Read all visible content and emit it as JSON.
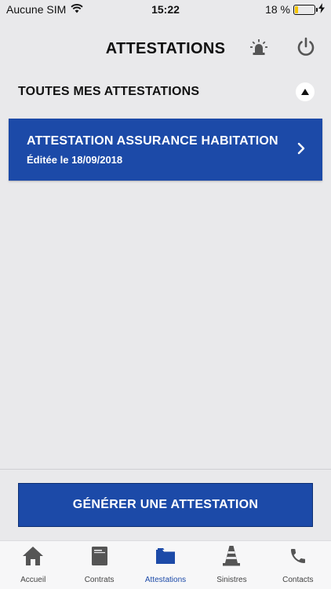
{
  "status_bar": {
    "carrier": "Aucune SIM",
    "time": "15:22",
    "battery": "18 %",
    "battery_level": 0.18
  },
  "header": {
    "title": "ATTESTATIONS"
  },
  "section": {
    "title": "TOUTES MES ATTESTATIONS"
  },
  "attestations": [
    {
      "title": "ATTESTATION ASSURANCE HABITATION",
      "subtitle": "Éditée le 18/09/2018"
    }
  ],
  "generate_button": {
    "label": "GÉNÉRER UNE ATTESTATION"
  },
  "tabs": [
    {
      "label": "Accueil",
      "icon": "home-icon"
    },
    {
      "label": "Contrats",
      "icon": "contract-icon"
    },
    {
      "label": "Attestations",
      "icon": "folder-icon",
      "active": true
    },
    {
      "label": "Sinistres",
      "icon": "cone-icon"
    },
    {
      "label": "Contacts",
      "icon": "phone-icon"
    }
  ],
  "colors": {
    "primary": "#1c4aa8",
    "background": "#e9e9eb",
    "tab_icon": "#555555",
    "battery": "#f5c400"
  }
}
